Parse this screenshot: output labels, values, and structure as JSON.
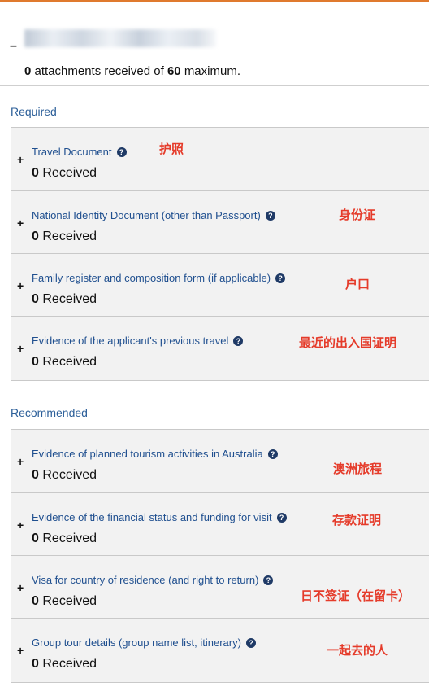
{
  "header": {
    "received_count": "0",
    "received_text": "attachments received of",
    "max_count": "60",
    "max_text": "maximum."
  },
  "sections": {
    "required": {
      "title": "Required",
      "items": [
        {
          "label": "Travel Document",
          "count": "0",
          "status": "Received",
          "note": "护照"
        },
        {
          "label": "National Identity Document (other than Passport)",
          "count": "0",
          "status": "Received",
          "note": "身份证"
        },
        {
          "label": "Family register and composition form (if applicable)",
          "count": "0",
          "status": "Received",
          "note": "户口"
        },
        {
          "label": "Evidence of the applicant's previous travel",
          "count": "0",
          "status": "Received",
          "note": "最近的出入国证明"
        }
      ]
    },
    "recommended": {
      "title": "Recommended",
      "items": [
        {
          "label": "Evidence of planned tourism activities in Australia",
          "count": "0",
          "status": "Received",
          "note": "澳洲旅程"
        },
        {
          "label": "Evidence of the financial status and funding for visit",
          "count": "0",
          "status": "Received",
          "note": "存款证明"
        },
        {
          "label": "Visa for country of residence (and right to return)",
          "count": "0",
          "status": "Received",
          "note": "日不签证（在留卡）"
        },
        {
          "label": "Group tour details (group name list, itinerary)",
          "count": "0",
          "status": "Received",
          "note": "一起去的人"
        }
      ]
    }
  },
  "icons": {
    "help": "question-circle-icon",
    "expand": "plus-icon",
    "collapse": "minus-icon"
  },
  "colors": {
    "accent_bar": "#e07a2e",
    "link": "#1f4f8f",
    "section_title": "#2c5f99",
    "annotation": "#e53b2a",
    "group_bg": "#f2f2f2"
  }
}
